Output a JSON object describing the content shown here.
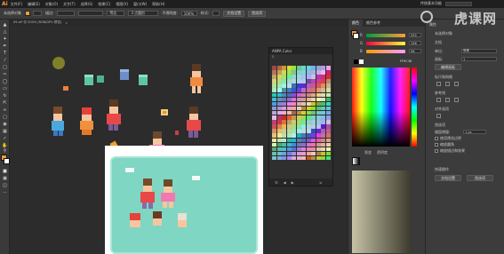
{
  "app": {
    "logo": "Ai",
    "workspace": "传统基本功能",
    "watermark": "虎课网"
  },
  "menubar": {
    "items": [
      "文件(F)",
      "编辑(E)",
      "对象(O)",
      "文字(T)",
      "选择(S)",
      "效果(C)",
      "视图(V)",
      "窗口(W)",
      "帮助(H)"
    ]
  },
  "control_bar": {
    "label_shape": "未选择对象",
    "stroke_label": "描边:",
    "uniform": "等比",
    "brush": "3 点圆形",
    "opacity_label": "不透明度:",
    "opacity_value": "100%",
    "style_label": "样式:",
    "doc_settings": "文档设置",
    "preferences": "首选项"
  },
  "tab": {
    "title": "05.ai* @ 200% (RGB/GPU 预览)",
    "close": "×"
  },
  "swatch_panel": {
    "title": "ANPA Color",
    "search_icon": "search-icon"
  },
  "color_panel": {
    "tabs": [
      "颜色",
      "颜色参考"
    ],
    "sliders": [
      {
        "label": "R",
        "value": "255"
      },
      {
        "label": "G",
        "value": "156"
      },
      {
        "label": "B",
        "value": "56"
      }
    ],
    "hex": "FF9C38",
    "sub_tabs": [
      "渐变",
      "透明度"
    ]
  },
  "props_panel": {
    "title": "属性",
    "no_selection": "未选择对象",
    "doc_label": "文档",
    "unit_label": "单位:",
    "unit_value": "像素",
    "artboard_label": "画板:",
    "artboard_value": "1",
    "edit_artboard": "编辑画板",
    "rulers_label": "标尺和网格",
    "guides_label": "参考线",
    "align_label": "对齐选项",
    "prefs_label": "首选项",
    "keyboard_incr": "键盘增量:",
    "keyboard_value": "1 px",
    "use_preview_bounds": "使用预览边界",
    "scale_corners": "缩放圆角",
    "scale_strokes": "缩放描边和效果",
    "quick_actions": "快速操作",
    "doc_settings_btn": "文档设置",
    "prefs_btn": "首选项"
  },
  "colors": {
    "accent": "#f39c38",
    "canvas": "#2c2c2c",
    "panel": "#3a3a3a",
    "mint": "#7fd6c2"
  }
}
